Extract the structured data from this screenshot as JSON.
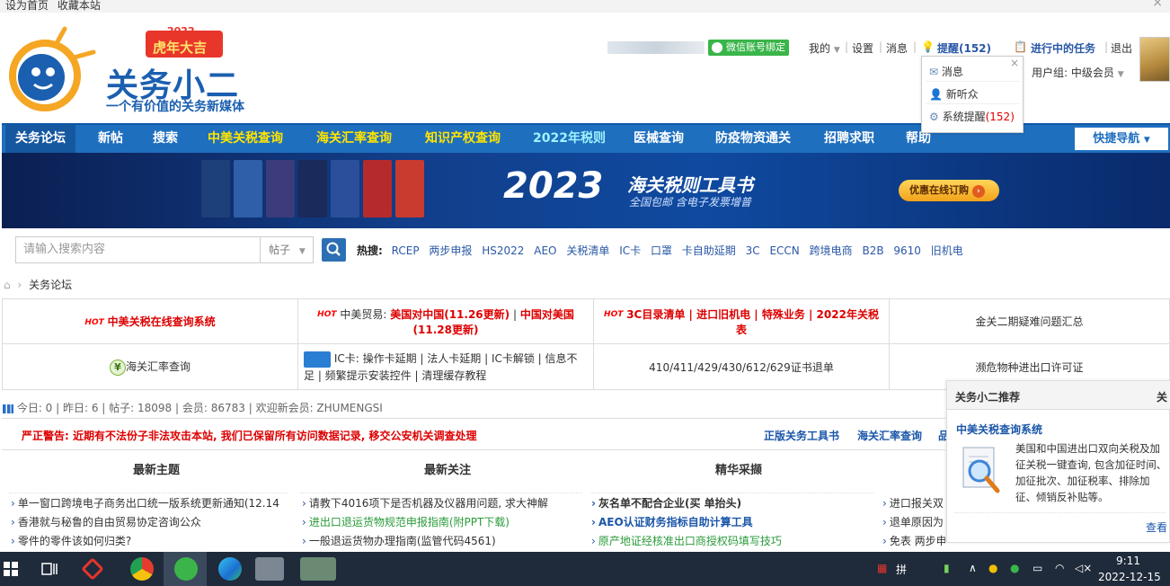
{
  "topbar": {
    "set_home": "设为首页",
    "bookmark": "收藏本站",
    "close": "×"
  },
  "logo": {
    "badge_year": "2022",
    "badge_text": "虎年大吉",
    "name": "关务小二",
    "slogan": "一个有价值的关务新媒体"
  },
  "user": {
    "wechat_bind": "微信账号绑定",
    "mine": "我的",
    "settings": "设置",
    "messages": "消息",
    "remind": "提醒(152)",
    "tasks": "进行中的任务",
    "logout": "退出",
    "usergroup": "用户组: 中级会员"
  },
  "remind_popup": {
    "items": [
      {
        "label": "消息"
      },
      {
        "label": "新听众"
      },
      {
        "label": "系统提醒",
        "count": "(152)"
      }
    ],
    "close": "×"
  },
  "nav": {
    "items": [
      {
        "label": "关务论坛"
      },
      {
        "label": "新帖"
      },
      {
        "label": "搜索"
      },
      {
        "label": "中美关税查询"
      },
      {
        "label": "海关汇率查询"
      },
      {
        "label": "知识产权查询"
      },
      {
        "label": "2022年税则"
      },
      {
        "label": "医械查询"
      },
      {
        "label": "防疫物资通关"
      },
      {
        "label": "招聘求职"
      },
      {
        "label": "帮助"
      }
    ],
    "quick_nav": "快捷导航"
  },
  "banner": {
    "headline": "2023",
    "headline_suffix": "海关税则工具书",
    "subline": "全国包邮 含电子发票增普",
    "cta": "优惠在线订购"
  },
  "search": {
    "placeholder": "请输入搜索内容",
    "scope": "帖子",
    "hot_label": "热搜:",
    "hot_terms": [
      "RCEP",
      "两步申报",
      "HS2022",
      "AEO",
      "关税清单",
      "IC卡",
      "口罩",
      "卡自助延期",
      "3C",
      "ECCN",
      "跨境电商",
      "B2B",
      "9610",
      "旧机电"
    ]
  },
  "breadcrumb": {
    "current": "关务论坛"
  },
  "grid": {
    "r1c1": "中美关税在线查询系统",
    "r1c2_prefix": "中美贸易:",
    "r1c2_a": "美国对中国(11.26更新)",
    "r1c2_b": "中国对美国(11.28更新)",
    "r1c3": "3C目录清单 | 进口旧机电 | 特殊业务 | 2022年关税表",
    "r1c4": "金关二期疑难问题汇总",
    "r2c1": "海关汇率查询",
    "r2c2": "IC卡: 操作卡延期 | 法人卡延期 | IC卡解锁 | 信息不足 | 频繁提示安装控件 | 清理缓存教程",
    "r2c3": "410/411/429/430/612/629证书退单",
    "r2c4": "濒危物种进出口许可证",
    "hot_badge": "HOT"
  },
  "stats": {
    "text": "今日: 0 | 昨日: 6 | 帖子: 18098 | 会员: 86783 | 欢迎新会员: ZHUMENGSI"
  },
  "warning": {
    "text": "严正警告: 近期有不法份子非法攻击本站, 我们已保留所有访问数据记录, 移交公安机关调查处理",
    "link1": "正版关务工具书",
    "link2": "海关汇率查询",
    "link3": "品"
  },
  "columns": [
    {
      "title": "最新主题",
      "items": [
        "单一窗口跨境电子商务出口统一版系统更新通知(12.14",
        "香港就与秘鲁的自由贸易协定咨询公众",
        "零件的零件该如何归类?"
      ]
    },
    {
      "title": "最新关注",
      "items": [
        "请教下4016项下是否机器及仪器用问题, 求大神解",
        "进出口退运货物规范申报指南(附PPT下载)",
        "一般退运货物办理指南(监管代码4561)"
      ]
    },
    {
      "title": "精华采撷",
      "items": [
        "灰名单不配合企业(买 单抬头)",
        "AEO认证财务指标自助计算工具",
        "原产地证经核准出口商授权码填写技巧"
      ]
    },
    {
      "title": "",
      "items": [
        "进口报关双",
        "退单原因为",
        "免表 两步申"
      ]
    }
  ],
  "recommend": {
    "title": "关务小二推荐",
    "title_right": "关",
    "item_title": "中美关税查询系统",
    "item_desc": "美国和中国进出口双向关税及加征关税一键查询, 包含加征时间、加征批次、加征税率、排除加征、倾销反补贴等。",
    "more": "查看"
  },
  "taskbar": {
    "ime": "拼",
    "time": "9:11",
    "date": "2022-12-15"
  },
  "colors": {
    "nav_blue": "#1f6fbf",
    "red": "#d00000",
    "link_blue": "#2a58a6",
    "nav_yellow": "#ffe500"
  }
}
